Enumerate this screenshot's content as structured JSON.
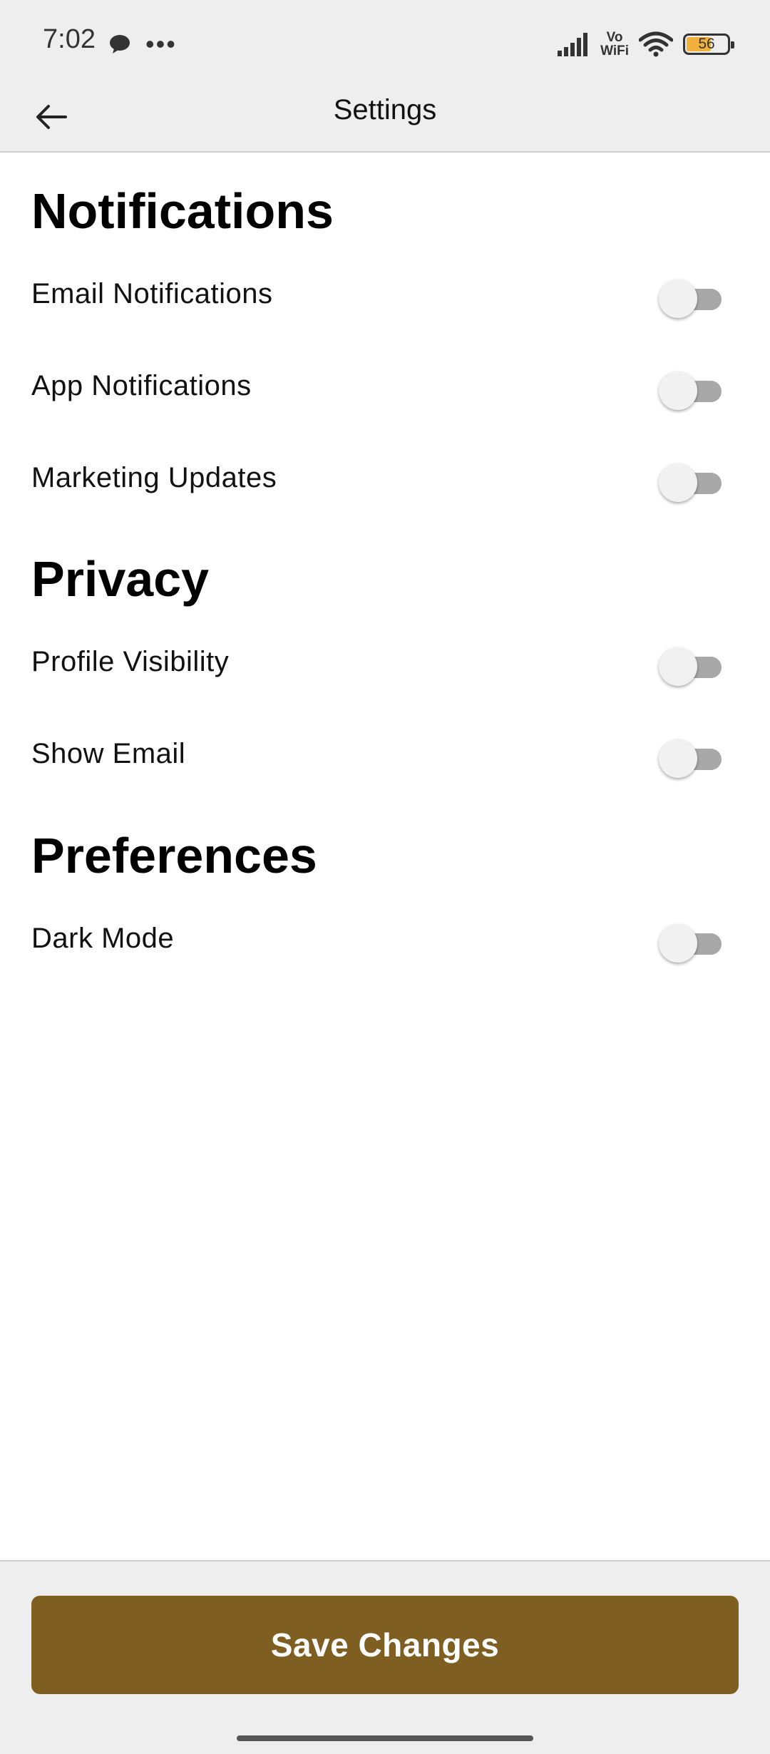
{
  "status_bar": {
    "time": "7:02",
    "vowifi_top": "Vo",
    "vowifi_bottom": "WiFi",
    "battery_level": "56",
    "icons": [
      "chat-icon",
      "more-icon",
      "signal-icon",
      "wifi-icon",
      "battery-icon"
    ]
  },
  "app_bar": {
    "back_icon": "arrow-left-icon",
    "title": "Settings"
  },
  "sections": {
    "notifications": {
      "title": "Notifications",
      "items": [
        {
          "label": "Email Notifications",
          "enabled": false
        },
        {
          "label": "App Notifications",
          "enabled": false
        },
        {
          "label": "Marketing Updates",
          "enabled": false
        }
      ]
    },
    "privacy": {
      "title": "Privacy",
      "items": [
        {
          "label": "Profile Visibility",
          "enabled": false
        },
        {
          "label": "Show Email",
          "enabled": false
        }
      ]
    },
    "preferences": {
      "title": "Preferences",
      "items": [
        {
          "label": "Dark Mode",
          "enabled": false
        }
      ]
    }
  },
  "footer": {
    "save_label": "Save Changes"
  },
  "colors": {
    "accent": "#7f5f21",
    "bar_background": "#eeeeee",
    "toggle_off_track": "#a8a8a8",
    "toggle_off_thumb": "#f1f1f1"
  }
}
